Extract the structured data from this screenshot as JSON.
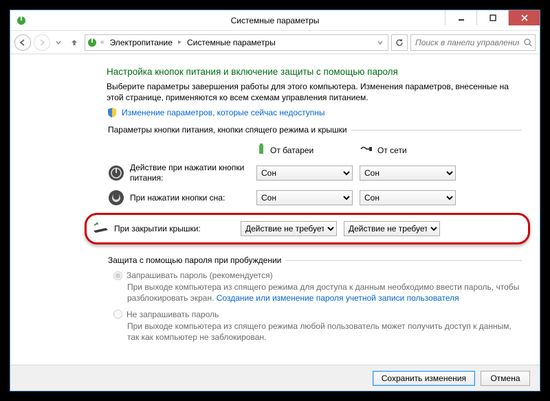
{
  "window": {
    "title": "Системные параметры"
  },
  "nav": {
    "crumb1": "Электропитание",
    "crumb2": "Системные параметры",
    "search_placeholder": "Поиск в панели управления"
  },
  "page": {
    "heading": "Настройка кнопок питания и включение защиты с помощью пароля",
    "desc": "Выберите параметры завершения работы для этого компьютера. Изменения параметров, внесенные на этой странице, применяются ко всем схемам управления питанием.",
    "unlock_link": "Изменение параметров, которые сейчас недоступны"
  },
  "group1": {
    "legend": "Параметры кнопки питания, кнопки спящего режима и крышки",
    "col_battery": "От батареи",
    "col_ac": "От сети",
    "row_power": {
      "label": "Действие при нажатии кнопки питания:",
      "battery": "Сон",
      "ac": "Сон"
    },
    "row_sleep": {
      "label": "При нажатии кнопки сна:",
      "battery": "Сон",
      "ac": "Сон"
    },
    "row_lid": {
      "label": "При закрытии крышки:",
      "battery": "Действие не требуется",
      "ac": "Действие не требуется"
    },
    "options": [
      "Сон",
      "Действие не требуется"
    ]
  },
  "group2": {
    "legend": "Защита с помощью пароля при пробуждении",
    "opt_require": {
      "title": "Запрашивать пароль (рекомендуется)",
      "body_pre": "При выходе компьютера из спящего режима для доступа к данным необходимо ввести пароль, чтобы разблокировать экран. ",
      "link": "Создание или изменение пароля учетной записи пользователя"
    },
    "opt_norequire": {
      "title": "Не запрашивать пароль",
      "body": "При выходе компьютера из спящего режима любой пользователь может получить доступ к данным, так как компьютер не заблокирован."
    }
  },
  "footer": {
    "save": "Сохранить изменения",
    "cancel": "Отмена"
  }
}
